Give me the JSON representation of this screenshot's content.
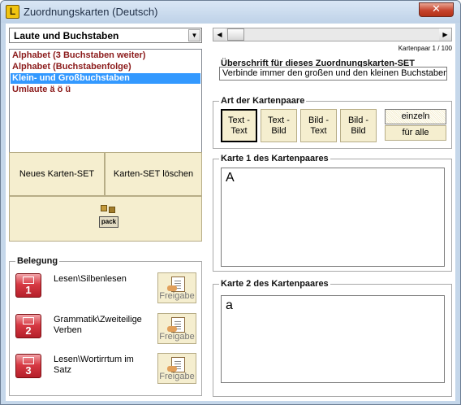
{
  "window": {
    "title": "Zuordnungskarten (Deutsch)",
    "app_icon": "L",
    "close_glyph": "✕"
  },
  "category": {
    "selected": "Laute und Buchstaben",
    "arrow": "▼"
  },
  "sets": [
    {
      "label": "Alphabet (3 Buchstaben weiter)",
      "selected": false
    },
    {
      "label": "Alphabet (Buchstabenfolge)",
      "selected": false
    },
    {
      "label": "Klein- und Großbuchstaben",
      "selected": true
    },
    {
      "label": "Umlaute ä ö ü",
      "selected": false
    }
  ],
  "buttons": {
    "new_set": "Neues Karten-SET",
    "delete_set": "Karten-SET löschen",
    "pack_label": "pack"
  },
  "assignment": {
    "title": "Belegung",
    "rows": [
      {
        "number": "1",
        "text": "Lesen\\Silbenlesen",
        "release": "Freigabe"
      },
      {
        "number": "2",
        "text": "Grammatik\\Zweiteilige Verben",
        "release": "Freigabe"
      },
      {
        "number": "3",
        "text": "Lesen\\Wortirrtum im Satz",
        "release": "Freigabe"
      }
    ]
  },
  "pair_scroll": {
    "left_arrow": "◀",
    "right_arrow": "▶",
    "counter": "Kartenpaar 1 / 100"
  },
  "heading_group": {
    "title": "Überschrift für dieses Zuordnungskarten-SET",
    "value": "Verbinde immer den großen und den kleinen Buchstaben"
  },
  "pair_type": {
    "title": "Art der Kartenpaare",
    "options": [
      {
        "line1": "Text -",
        "line2": "Text",
        "active": true
      },
      {
        "line1": "Text -",
        "line2": "Bild",
        "active": false
      },
      {
        "line1": "Bild -",
        "line2": "Text",
        "active": false
      },
      {
        "line1": "Bild -",
        "line2": "Bild",
        "active": false
      }
    ],
    "single": "einzeln",
    "for_all": "für alle"
  },
  "card1": {
    "title": "Karte 1 des Kartenpaares",
    "value": "A"
  },
  "card2": {
    "title": "Karte 2 des Kartenpaares",
    "value": "a"
  }
}
